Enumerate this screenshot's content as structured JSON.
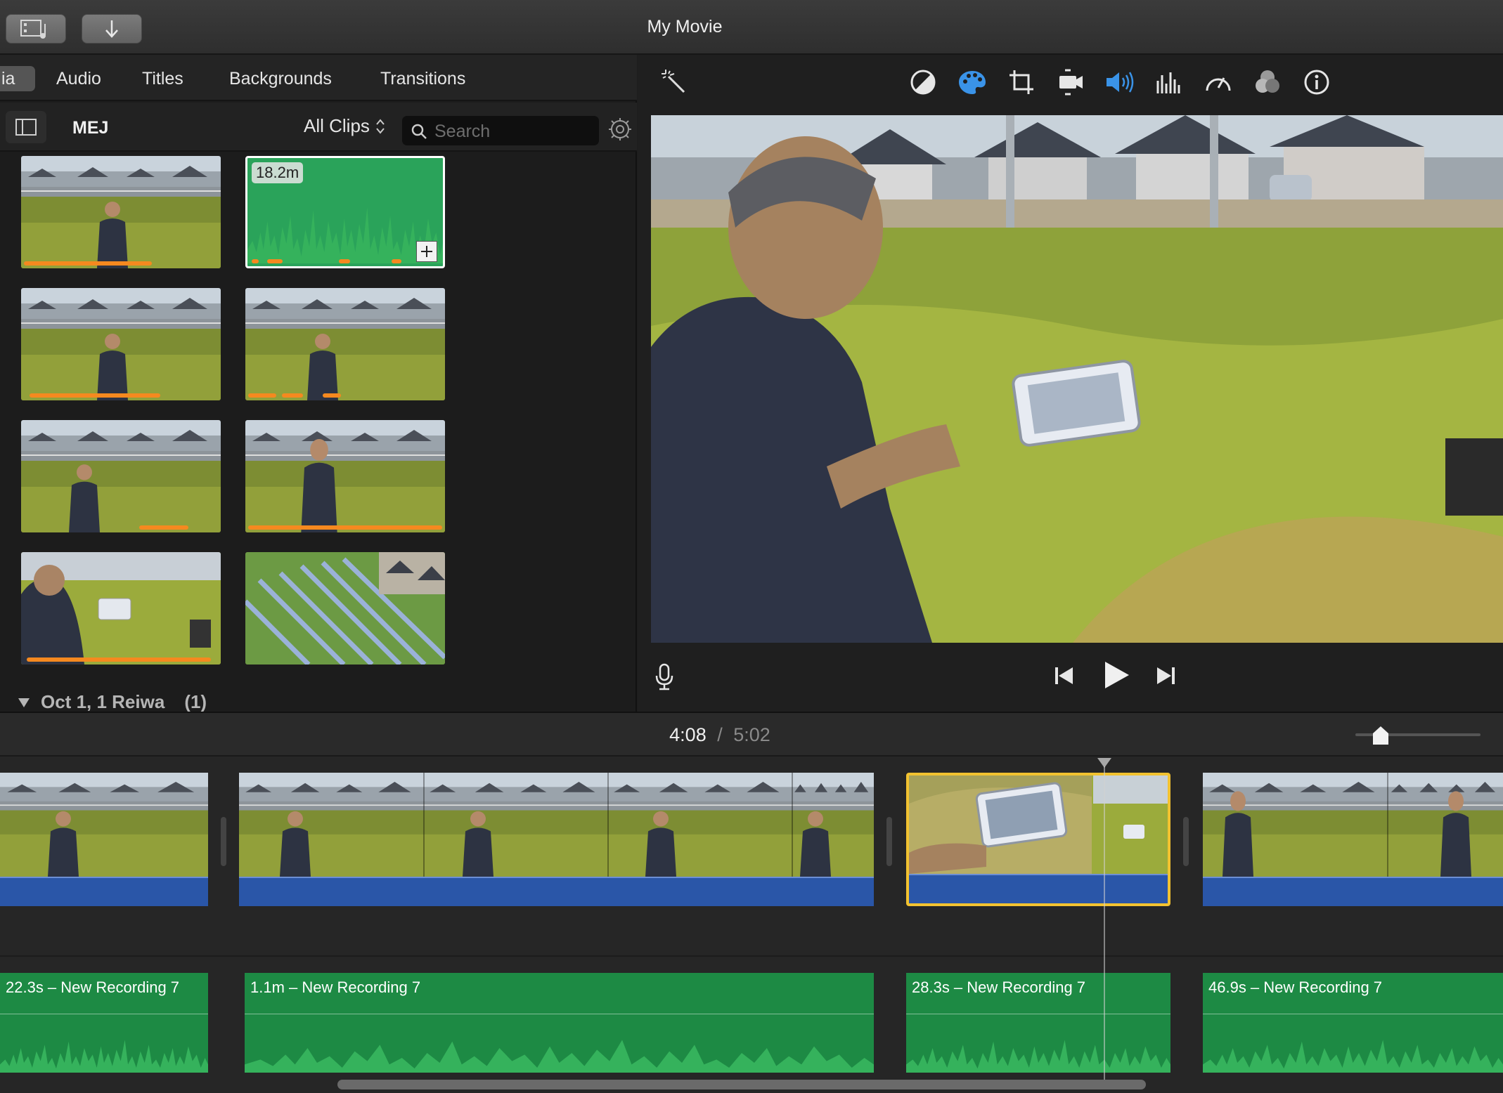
{
  "window": {
    "title": "My Movie"
  },
  "browser": {
    "tabs": [
      "ia",
      "Audio",
      "Titles",
      "Backgrounds",
      "Transitions"
    ],
    "library_name": "MEJ",
    "filter": "All Clips",
    "search_placeholder": "Search",
    "audio_clip_duration": "18.2m",
    "section_header": {
      "label": "Oct 1, 1 Reiwa",
      "count": "(1)"
    }
  },
  "viewer": {
    "tools": [
      "magic-wand-icon",
      "color-balance-icon",
      "color-correction-icon",
      "crop-icon",
      "stabilization-icon",
      "volume-icon",
      "equalizer-icon",
      "speed-icon",
      "clip-filter-icon",
      "info-icon"
    ]
  },
  "timeline": {
    "current_time": "4:08",
    "separator": "/",
    "total_time": "5:02",
    "zoom_level": 0.18,
    "audio_clips": [
      "22.3s – New Recording 7",
      "1.1m – New Recording 7",
      "28.3s – New Recording 7",
      "46.9s – New Recording 7"
    ]
  },
  "colors": {
    "accent_orange": "#f5891f",
    "audio_green": "#1d8a44",
    "selection_yellow": "#f2c230",
    "tool_blue": "#3a93e8",
    "clip_blue": "#2a56a8"
  }
}
